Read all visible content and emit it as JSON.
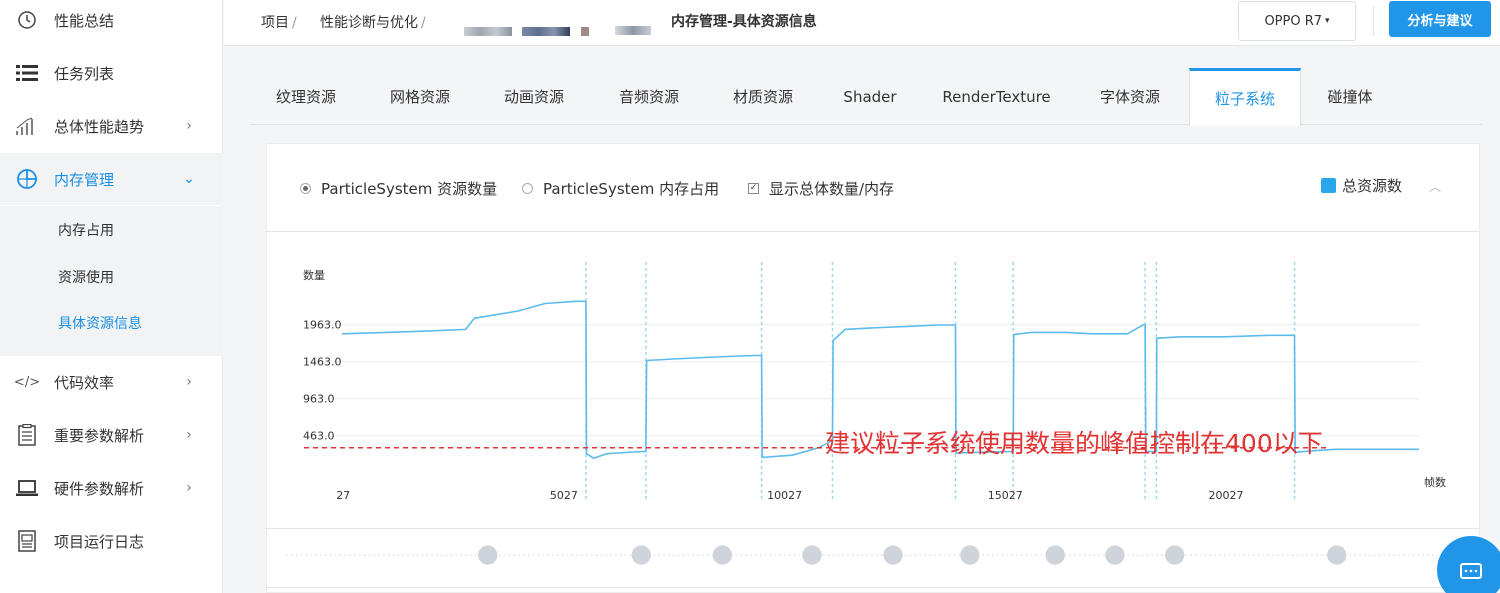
{
  "sidebar": {
    "items": [
      {
        "label": "性能总结",
        "icon": "clock-icon"
      },
      {
        "label": "任务列表",
        "icon": "list-icon"
      },
      {
        "label": "总体性能趋势",
        "icon": "bar-chart-icon",
        "arrow": "›"
      },
      {
        "label": "内存管理",
        "icon": "pie-chart-icon",
        "arrow": "⌄"
      },
      {
        "label": "代码效率",
        "icon": "code-icon",
        "arrow": "›"
      },
      {
        "label": "重要参数解析",
        "icon": "clipboard-icon",
        "arrow": "›"
      },
      {
        "label": "硬件参数解析",
        "icon": "laptop-icon",
        "arrow": "›"
      },
      {
        "label": "项目运行日志",
        "icon": "log-icon"
      }
    ],
    "submenu": [
      {
        "label": "内存占用"
      },
      {
        "label": "资源使用"
      },
      {
        "label": "具体资源信息"
      }
    ]
  },
  "header": {
    "breadcrumb": [
      "项目",
      "性能诊断与优化"
    ],
    "separator": "/",
    "title": "内存管理-具体资源信息",
    "device": "OPPO R7",
    "device_caret": "▾",
    "analyze_button": "分析与建议"
  },
  "tabs": [
    {
      "label": "纹理资源"
    },
    {
      "label": "网格资源"
    },
    {
      "label": "动画资源"
    },
    {
      "label": "音频资源"
    },
    {
      "label": "材质资源"
    },
    {
      "label": "Shader"
    },
    {
      "label": "RenderTexture"
    },
    {
      "label": "字体资源"
    },
    {
      "label": "粒子系统",
      "active": true
    },
    {
      "label": "碰撞体"
    }
  ],
  "panel": {
    "options": [
      {
        "label": "ParticleSystem 资源数量",
        "type": "radio",
        "checked": true
      },
      {
        "label": "ParticleSystem 内存占用",
        "type": "radio",
        "checked": false
      },
      {
        "label": "显示总体数量/内存",
        "type": "checkbox",
        "checked": true
      }
    ],
    "legend": "总资源数",
    "collapse_icon": "︿"
  },
  "chart_data": {
    "type": "line",
    "ylabel": "数量",
    "xlabel": "帧数",
    "y_ticks": [
      "1963.0",
      "1463.0",
      "963.0",
      "463.0"
    ],
    "x_ticks": [
      "27",
      "5027",
      "10027",
      "15027",
      "20027"
    ],
    "ylim": [
      0,
      2500
    ],
    "xlim": [
      0,
      24400
    ],
    "annotation": "建议粒子系统使用数量的峰值控制在400以下",
    "threshold": 300,
    "series": [
      {
        "color": "#5bbcec",
        "points": [
          [
            0,
            1840
          ],
          [
            1000,
            1860
          ],
          [
            2000,
            1880
          ],
          [
            2800,
            1900
          ],
          [
            3000,
            2050
          ],
          [
            3500,
            2100
          ],
          [
            4000,
            2150
          ],
          [
            4600,
            2250
          ],
          [
            5300,
            2280
          ],
          [
            5526,
            2280
          ],
          [
            5540,
            220
          ],
          [
            5700,
            160
          ],
          [
            6000,
            220
          ],
          [
            6800,
            250
          ],
          [
            6885,
            250
          ],
          [
            6900,
            1480
          ],
          [
            7500,
            1500
          ],
          [
            8200,
            1520
          ],
          [
            9000,
            1540
          ],
          [
            9506,
            1550
          ],
          [
            9520,
            170
          ],
          [
            10200,
            200
          ],
          [
            10800,
            300
          ],
          [
            11112,
            400
          ],
          [
            11125,
            1750
          ],
          [
            11400,
            1900
          ],
          [
            12000,
            1920
          ],
          [
            12800,
            1940
          ],
          [
            13500,
            1960
          ],
          [
            13899,
            1960
          ],
          [
            13910,
            230
          ],
          [
            14500,
            240
          ],
          [
            15206,
            250
          ],
          [
            15220,
            1830
          ],
          [
            15600,
            1860
          ],
          [
            16400,
            1860
          ],
          [
            17000,
            1840
          ],
          [
            17800,
            1840
          ],
          [
            18140,
            1960
          ],
          [
            18195,
            1960
          ],
          [
            18210,
            250
          ],
          [
            18450,
            250
          ],
          [
            18460,
            1780
          ],
          [
            19000,
            1800
          ],
          [
            20000,
            1800
          ],
          [
            21000,
            1820
          ],
          [
            21580,
            1820
          ],
          [
            21595,
            240
          ],
          [
            22000,
            260
          ],
          [
            22500,
            280
          ],
          [
            23500,
            280
          ],
          [
            24400,
            280
          ]
        ]
      }
    ],
    "markers_x": [
      5526,
      6885,
      9506,
      11112,
      13899,
      15206,
      18195,
      18450,
      21580
    ]
  },
  "slider": {
    "dots_x": [
      3000,
      6600,
      8500,
      10600,
      12500,
      14300,
      16300,
      17700,
      19100,
      22900
    ]
  },
  "colors": {
    "accent": "#2196e8",
    "series": "#5bbcec",
    "annotation": "#e23333"
  }
}
